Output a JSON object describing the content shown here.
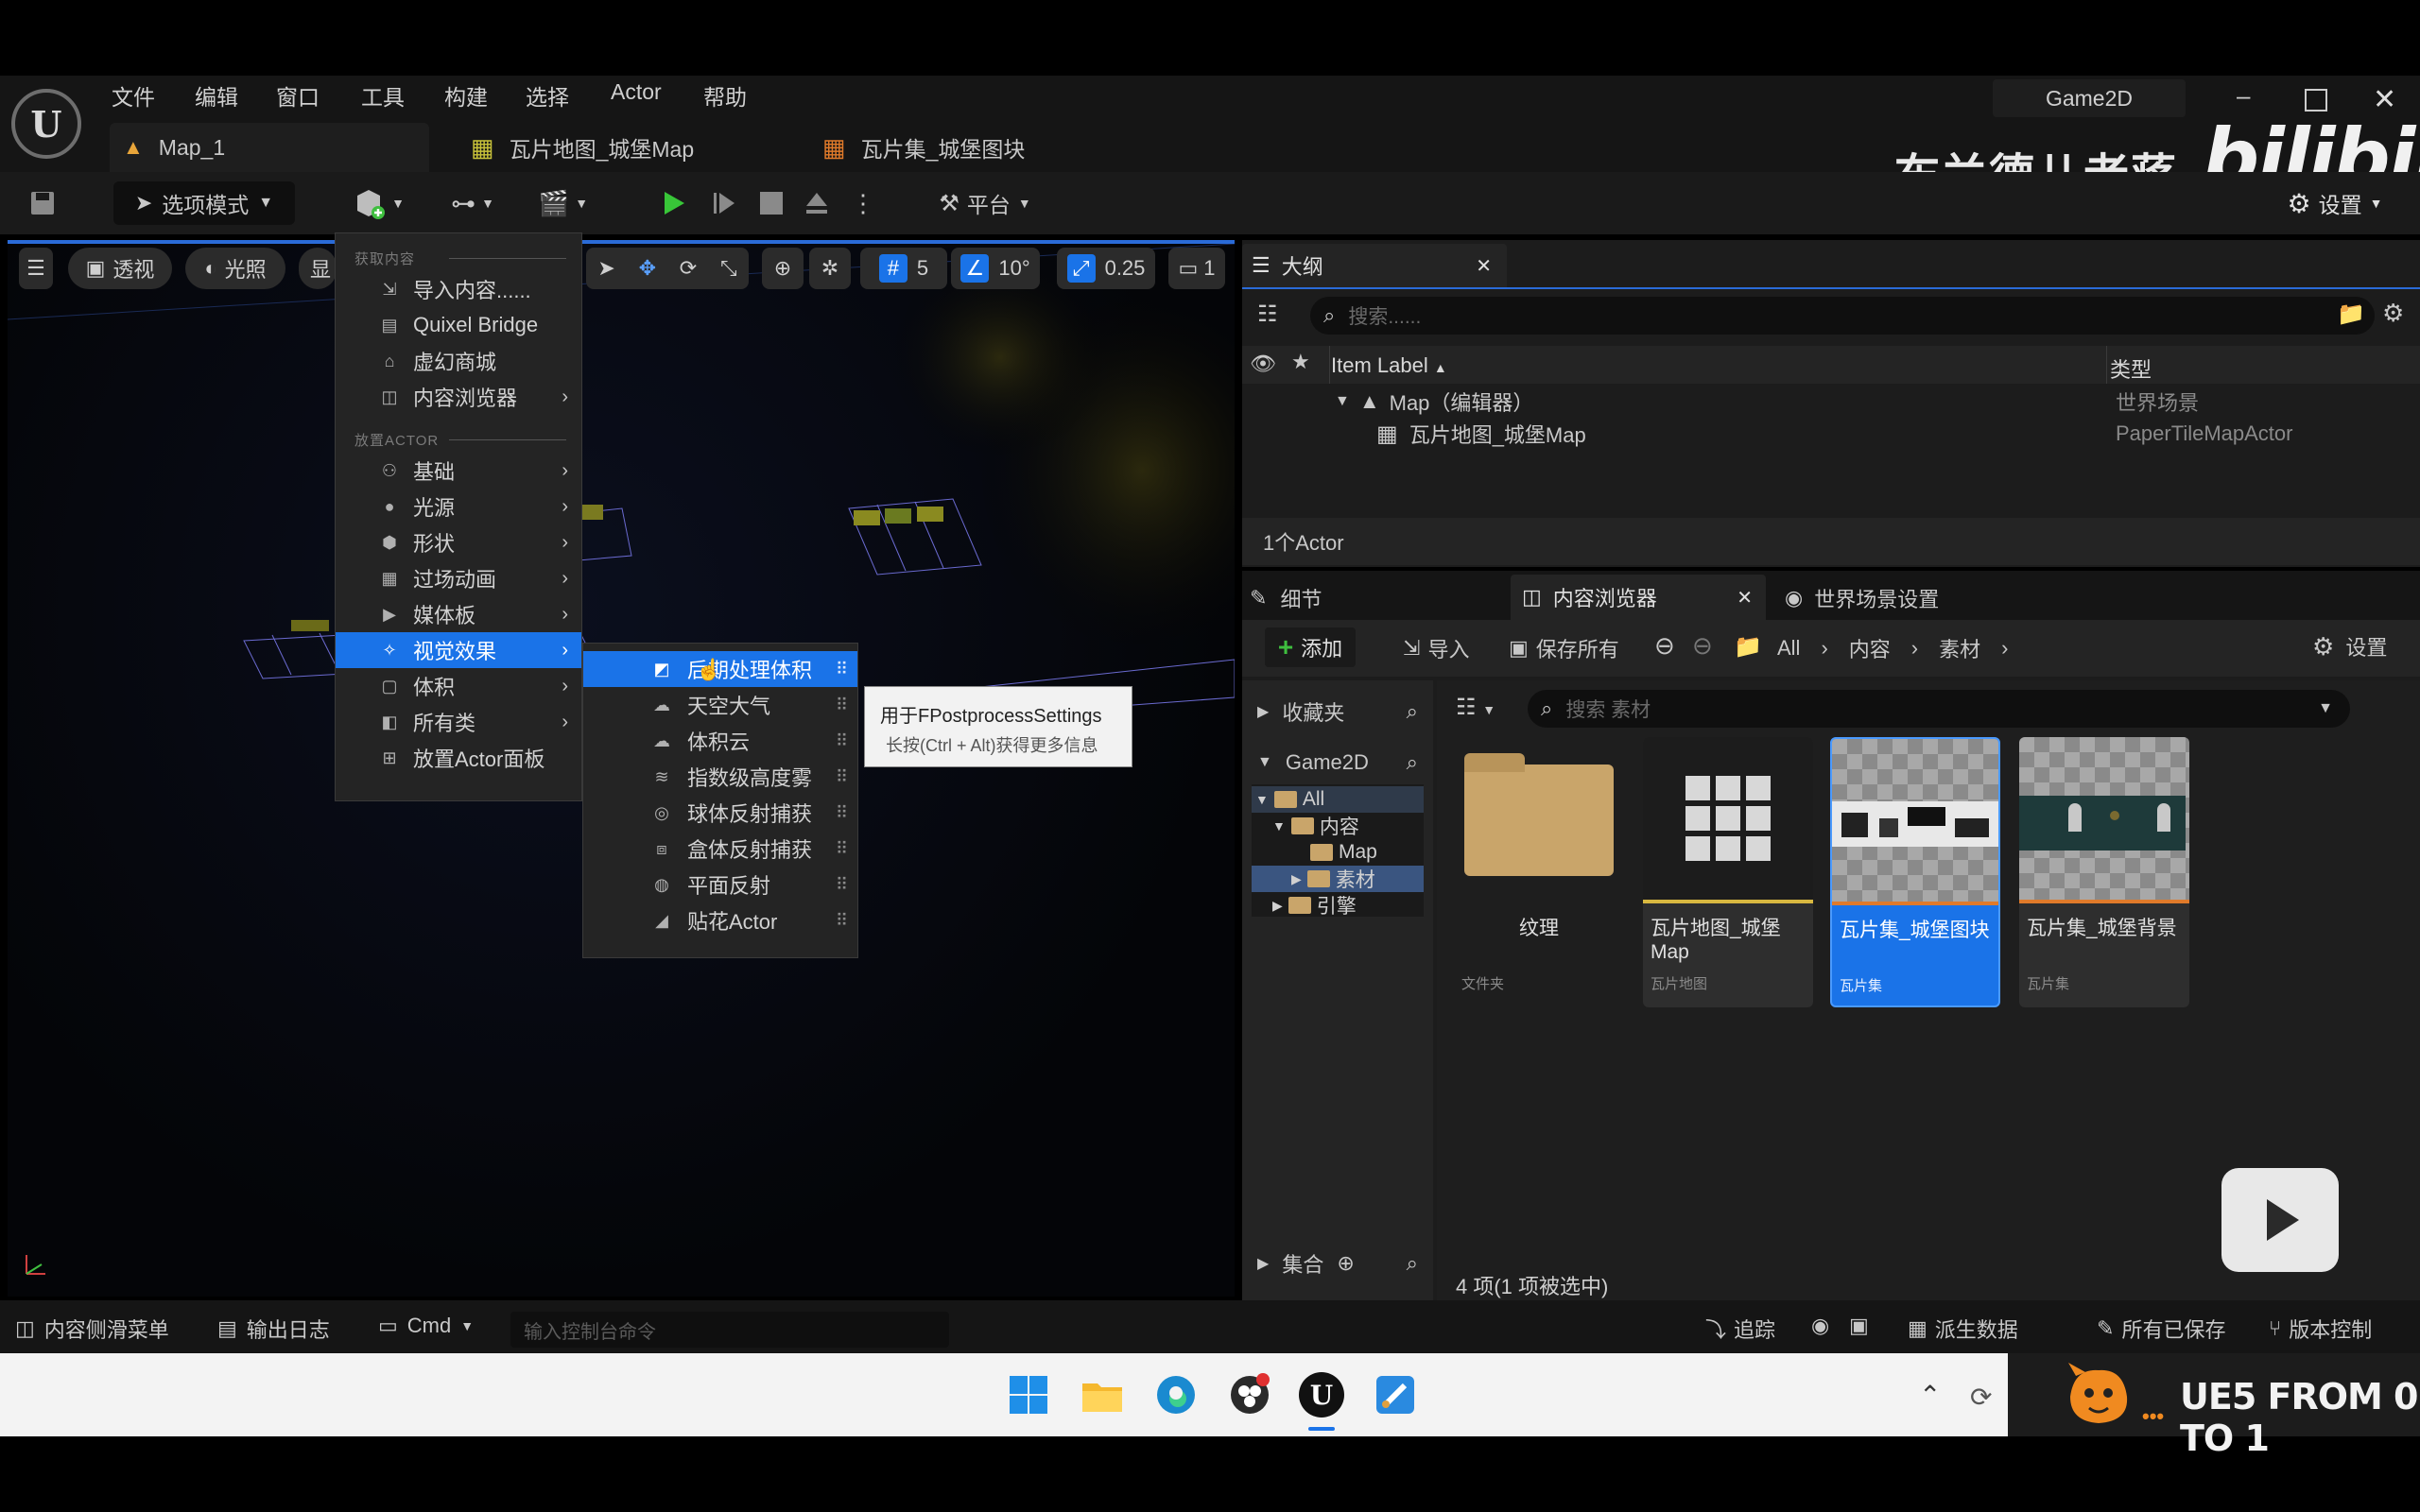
{
  "menubar": {
    "items": [
      "文件",
      "编辑",
      "窗口",
      "工具",
      "构建",
      "选择",
      "Actor",
      "帮助"
    ],
    "project": "Game2D"
  },
  "tabs": [
    {
      "label": "Map_1"
    },
    {
      "label": "瓦片地图_城堡Map"
    },
    {
      "label": "瓦片集_城堡图块"
    }
  ],
  "watermark": {
    "author": "布兰德儿老蒋",
    "brand": "bilibili",
    "course": "UE5 FROM 0 TO 1"
  },
  "toolbar": {
    "mode": "选项模式",
    "platform": "平台",
    "settings": "设置"
  },
  "viewport": {
    "perspective": "透视",
    "lit": "光照",
    "show": "显",
    "grid": "5",
    "angle": "10°",
    "scale": "0.25",
    "camera": "1"
  },
  "create_menu": {
    "section_get": "获取内容",
    "get_items": [
      {
        "label": "导入内容......",
        "icon": "import-icon"
      },
      {
        "label": "Quixel Bridge",
        "icon": "bridge-icon"
      },
      {
        "label": "虚幻商城",
        "icon": "marketplace-icon"
      },
      {
        "label": "内容浏览器",
        "icon": "content-browser-icon"
      }
    ],
    "section_place": "放置ACTOR",
    "place_items": [
      {
        "label": "基础"
      },
      {
        "label": "光源"
      },
      {
        "label": "形状"
      },
      {
        "label": "过场动画"
      },
      {
        "label": "媒体板"
      },
      {
        "label": "视觉效果"
      },
      {
        "label": "体积"
      },
      {
        "label": "所有类"
      },
      {
        "label": "放置Actor面板"
      }
    ]
  },
  "visual_submenu": [
    "后期处理体积",
    "天空大气",
    "体积云",
    "指数级高度雾",
    "球体反射捕获",
    "盒体反射捕获",
    "平面反射",
    "贴花Actor"
  ],
  "tooltip": {
    "title": "用于FPostprocessSettings",
    "hint": "长按(Ctrl + Alt)获得更多信息"
  },
  "outliner": {
    "tab": "大纲",
    "search_placeholder": "搜索......",
    "col_label": "Item Label",
    "col_type": "类型",
    "rows": [
      {
        "label": "Map（编辑器）",
        "type": "世界场景"
      },
      {
        "label": "瓦片地图_城堡Map",
        "type": "PaperTileMapActor"
      }
    ],
    "count": "1个Actor"
  },
  "lower_tabs": [
    "细节",
    "内容浏览器",
    "世界场景设置"
  ],
  "content_browser": {
    "add": "添加",
    "import": "导入",
    "save_all": "保存所有",
    "settings": "设置",
    "path": [
      "All",
      "内容",
      "素材"
    ],
    "favorites": "收藏夹",
    "project": "Game2D",
    "collections": "集合",
    "search_placeholder": "搜索 素材",
    "tree": [
      "All",
      "内容",
      "Map",
      "素材",
      "引擎"
    ],
    "assets": [
      {
        "name": "纹理",
        "type": "文件夹"
      },
      {
        "name": "瓦片地图_城堡Map",
        "type": "瓦片地图"
      },
      {
        "name": "瓦片集_城堡图块",
        "type": "瓦片集"
      },
      {
        "name": "瓦片集_城堡背景",
        "type": "瓦片集"
      }
    ],
    "count": "4 项(1 项被选中)"
  },
  "statusbar": {
    "drawer": "内容侧滑菜单",
    "log": "输出日志",
    "cmd": "Cmd",
    "cmd_placeholder": "输入控制台命令",
    "trace": "追踪",
    "derived": "派生数据",
    "saved": "所有已保存",
    "revision": "版本控制"
  }
}
